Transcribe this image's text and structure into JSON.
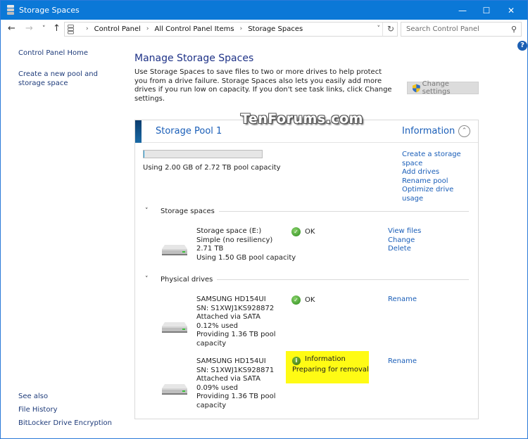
{
  "window": {
    "title": "Storage Spaces",
    "controls": {
      "minimize": "—",
      "maximize": "☐",
      "close": "✕"
    }
  },
  "address": {
    "breadcrumbs": [
      "Control Panel",
      "All Control Panel Items",
      "Storage Spaces"
    ],
    "search_placeholder": "Search Control Panel"
  },
  "icons": {
    "back": "←",
    "forward": "→",
    "recent": "˅",
    "up": "↑",
    "dropdown": "˅",
    "refresh": "↻",
    "search": "⚲",
    "help": "?",
    "chevron_down": "˅",
    "collapse": "⌃",
    "check": "✓",
    "info": "i"
  },
  "sidebar": {
    "home": "Control Panel Home",
    "create_pool": "Create a new pool and storage space",
    "see_also_label": "See also",
    "see_also": [
      "File History",
      "BitLocker Drive Encryption"
    ]
  },
  "main": {
    "heading": "Manage Storage Spaces",
    "description": "Use Storage Spaces to save files to two or more drives to help protect you from a drive failure. Storage Spaces also lets you easily add more drives if you run low on capacity. If you don't see task links, click Change settings.",
    "change_settings": "Change settings"
  },
  "watermark": "TenForums.com",
  "pool": {
    "title": "Storage Pool 1",
    "info_label": "Information",
    "capacity_text": "Using 2.00 GB of 2.72 TB pool capacity",
    "capacity_used_fraction": 0.0007,
    "links": [
      "Create a storage space",
      "Add drives",
      "Rename pool",
      "Optimize drive usage"
    ],
    "storage_spaces_label": "Storage spaces",
    "physical_drives_label": "Physical drives",
    "storage_spaces": [
      {
        "lines": [
          "Storage space (E:)",
          "Simple (no resiliency)",
          "2.71 TB",
          "Using 1.50 GB pool capacity"
        ],
        "status": "OK",
        "links": [
          "View files",
          "Change",
          "Delete"
        ]
      }
    ],
    "physical_drives": [
      {
        "lines": [
          "SAMSUNG HD154UI",
          "SN: S1XWJ1KS928872",
          "Attached via SATA",
          "0.12% used",
          "Providing 1.36 TB pool",
          "capacity"
        ],
        "status": "OK",
        "links": [
          "Rename"
        ]
      },
      {
        "lines": [
          "SAMSUNG HD154UI",
          "SN: S1XWJ1KS928871",
          "Attached via SATA",
          "0.09% used",
          "Providing 1.36 TB pool",
          "capacity"
        ],
        "status": "Information",
        "status_detail": "Preparing for removal",
        "highlight_color": "#fffb14",
        "links": [
          "Rename"
        ]
      }
    ]
  },
  "colors": {
    "titlebar": "#0b78d7",
    "link": "#1a5eb8",
    "heading": "#1e3287"
  }
}
